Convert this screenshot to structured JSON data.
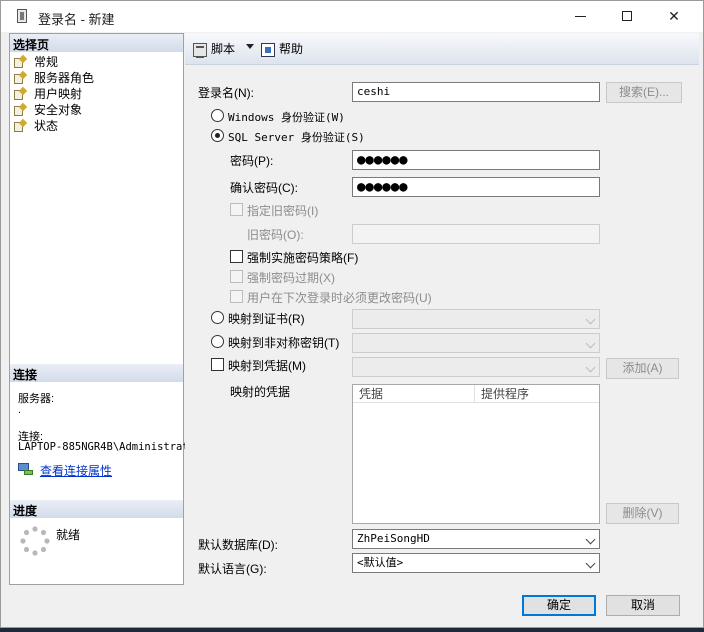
{
  "window": {
    "title": "登录名 - 新建"
  },
  "left": {
    "select_page_header": "选择页",
    "pages": [
      "常规",
      "服务器角色",
      "用户映射",
      "安全对象",
      "状态"
    ],
    "connection_header": "连接",
    "server_label": "服务器:",
    "server_value": ".",
    "connection_label": "连接:",
    "connection_value": "LAPTOP-885NGR4B\\Administrat",
    "view_props_link": "查看连接属性",
    "progress_header": "进度",
    "progress_status": "就绪"
  },
  "toolbar": {
    "script_label": "脚本",
    "help_label": "帮助"
  },
  "form": {
    "login_name_label": "登录名(N):",
    "login_name_value": "ceshi",
    "search_button": "搜索(E)...",
    "windows_auth": "Windows 身份验证(W)",
    "sql_auth": "SQL Server 身份验证(S)",
    "password_label": "密码(P):",
    "password_value": "●●●●●●",
    "confirm_password_label": "确认密码(C):",
    "confirm_password_value": "●●●●●●",
    "specify_old_password": "指定旧密码(I)",
    "old_password_label": "旧密码(O):",
    "enforce_policy": "强制实施密码策略(F)",
    "enforce_expiration": "强制密码过期(X)",
    "must_change": "用户在下次登录时必须更改密码(U)",
    "map_cert": "映射到证书(R)",
    "map_asym_key": "映射到非对称密钥(T)",
    "map_credential": "映射到凭据(M)",
    "add_button": "添加(A)",
    "mapped_credentials_label": "映射的凭据",
    "grid_col_credential": "凭据",
    "grid_col_provider": "提供程序",
    "remove_button": "删除(V)",
    "default_db_label": "默认数据库(D):",
    "default_db_value": "ZhPeiSongHD",
    "default_lang_label": "默认语言(G):",
    "default_lang_value": "<默认值>"
  },
  "footer": {
    "ok_button": "确定",
    "cancel_button": "取消"
  }
}
